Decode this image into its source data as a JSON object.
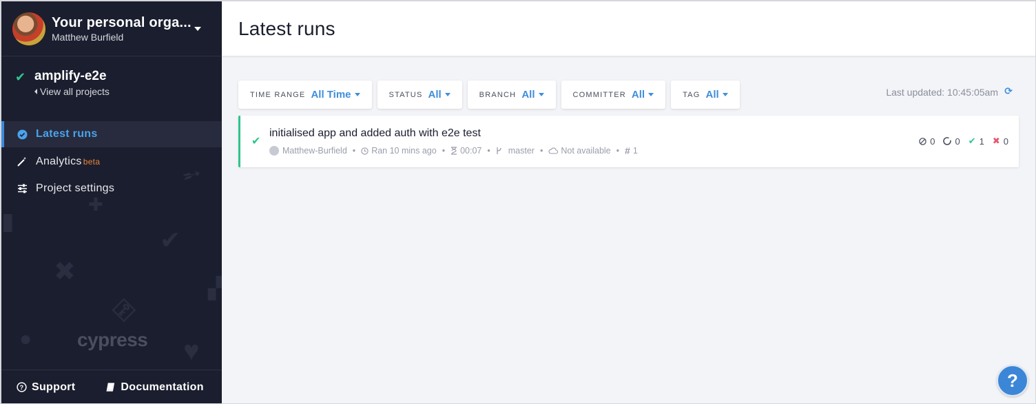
{
  "sidebar": {
    "org": {
      "name": "Your personal orga...",
      "user": "Matthew Burfield"
    },
    "project": {
      "name": "amplify-e2e",
      "view_all": "View all projects"
    },
    "nav": [
      {
        "label": "Latest runs",
        "icon": "check-circle-icon",
        "active": true
      },
      {
        "label": "Analytics",
        "icon": "magic-wand-icon",
        "badge": "beta"
      },
      {
        "label": "Project settings",
        "icon": "sliders-icon"
      }
    ],
    "logo": "cypress",
    "footer": {
      "support": "Support",
      "documentation": "Documentation"
    }
  },
  "main": {
    "title": "Latest runs",
    "filters": [
      {
        "label": "TIME RANGE",
        "value": "All Time"
      },
      {
        "label": "STATUS",
        "value": "All"
      },
      {
        "label": "BRANCH",
        "value": "All"
      },
      {
        "label": "COMMITTER",
        "value": "All"
      },
      {
        "label": "TAG",
        "value": "All"
      }
    ],
    "last_updated": "Last updated: 10:45:05am",
    "run": {
      "title": "initialised app and added auth with e2e test",
      "author": "Matthew-Burfield",
      "ran": "Ran 10 mins ago",
      "duration": "00:07",
      "branch": "master",
      "os": "Not available",
      "number": "1",
      "counts": {
        "skipped": "0",
        "pending": "0",
        "passed": "1",
        "failed": "0"
      }
    }
  },
  "colors": {
    "accent": "#3e8edb",
    "success": "#31c48d",
    "failure": "#e45770",
    "sidebar_bg": "#1b1e2e",
    "beta": "#e8863b"
  }
}
